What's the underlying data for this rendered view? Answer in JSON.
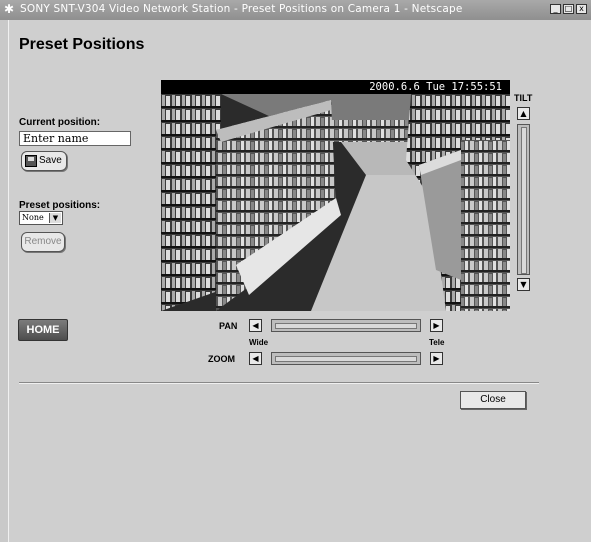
{
  "window": {
    "title": "SONY SNT-V304 Video Network Station - Preset Positions on Camera 1 - Netscape",
    "app_icon": "netscape-icon",
    "controls": {
      "minimize": "_",
      "maximize": "□",
      "close": "x"
    }
  },
  "page": {
    "title": "Preset Positions"
  },
  "current_position": {
    "label": "Current position:",
    "input_value": "Enter name",
    "save_label": "Save"
  },
  "preset": {
    "label": "Preset positions:",
    "selected": "None",
    "remove_label": "Remove"
  },
  "home_label": "HOME",
  "video": {
    "timestamp": "2000.6.6 Tue 17:55:51"
  },
  "controls": {
    "tilt_label": "TILT",
    "pan_label": "PAN",
    "zoom_label": "ZOOM",
    "wide_label": "Wide",
    "tele_label": "Tele",
    "up_glyph": "▲",
    "down_glyph": "▼",
    "left_glyph": "◀",
    "right_glyph": "▶"
  },
  "close_label": "Close"
}
